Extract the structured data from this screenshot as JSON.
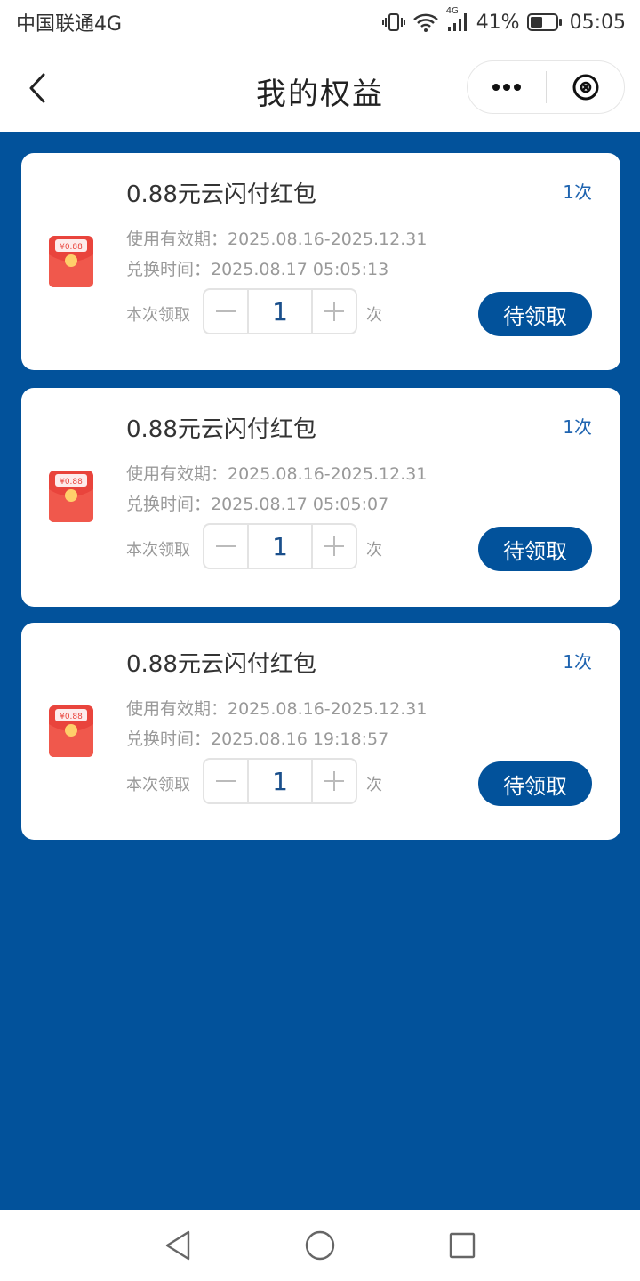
{
  "status_bar": {
    "carrier": "中国联通4G",
    "network": "4G",
    "battery": "41%",
    "time": "05:05"
  },
  "header": {
    "title": "我的权益"
  },
  "cards": [
    {
      "title": "0.88元云闪付红包",
      "count": "1次",
      "validity": "使用有效期：2025.08.16-2025.12.31",
      "exchange_time": "兑换时间：2025.08.17 05:05:13",
      "qty_label": "本次领取",
      "qty_value": "1",
      "qty_unit": "次",
      "button": "待领取",
      "envelope_label": "¥0.88"
    },
    {
      "title": "0.88元云闪付红包",
      "count": "1次",
      "validity": "使用有效期：2025.08.16-2025.12.31",
      "exchange_time": "兑换时间：2025.08.17 05:05:07",
      "qty_label": "本次领取",
      "qty_value": "1",
      "qty_unit": "次",
      "button": "待领取",
      "envelope_label": "¥0.88"
    },
    {
      "title": "0.88元云闪付红包",
      "count": "1次",
      "validity": "使用有效期：2025.08.16-2025.12.31",
      "exchange_time": "兑换时间：2025.08.16 19:18:57",
      "qty_label": "本次领取",
      "qty_value": "1",
      "qty_unit": "次",
      "button": "待领取",
      "envelope_label": "¥0.88"
    }
  ],
  "icons": {
    "back": "chevron-left-icon",
    "more": "more-dots-icon",
    "close": "close-circle-icon",
    "envelope": "red-envelope-icon"
  },
  "colors": {
    "brand_blue": "#02529b",
    "count_blue": "#1f64b0",
    "envelope_red": "#e9443c"
  }
}
